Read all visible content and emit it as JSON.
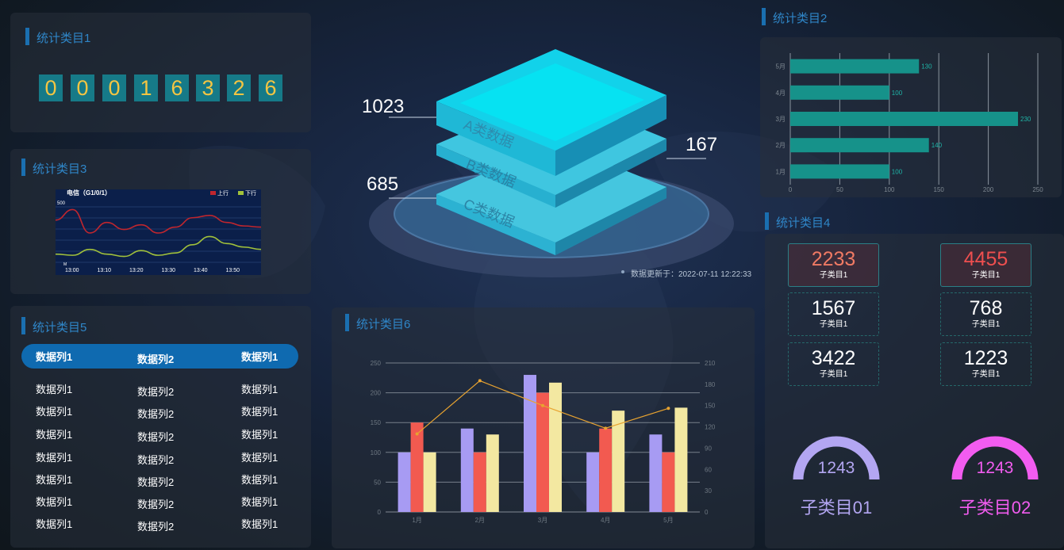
{
  "panels": {
    "p1": {
      "title": "统计类目1",
      "digits": [
        "0",
        "0",
        "0",
        "1",
        "6",
        "3",
        "2",
        "6"
      ]
    },
    "p2": {
      "title": "统计类目2"
    },
    "p3": {
      "title": "统计类目3",
      "chart_title": "电信（G1/0/1）",
      "legend_up": "上行",
      "legend_down": "下行",
      "y_label": "500",
      "y_label2": "M"
    },
    "p4": {
      "title": "统计类目4"
    },
    "p5": {
      "title": "统计类目5",
      "header": [
        "数据列1",
        "数据列2",
        "数据列1"
      ],
      "rows": [
        [
          "数据列1",
          "数据列2",
          "数据列1"
        ],
        [
          "数据列1",
          "数据列2",
          "数据列1"
        ],
        [
          "数据列1",
          "数据列2",
          "数据列1"
        ],
        [
          "数据列1",
          "数据列2",
          "数据列1"
        ],
        [
          "数据列1",
          "数据列2",
          "数据列1"
        ],
        [
          "数据列1",
          "数据列2",
          "数据列1"
        ],
        [
          "数据列1",
          "数据列2",
          "数据列1"
        ]
      ]
    },
    "p6": {
      "title": "统计类目6"
    }
  },
  "center": {
    "layers": [
      "A类数据",
      "B类数据",
      "C类数据"
    ],
    "values": {
      "a": "1023",
      "b": "685",
      "c": "167"
    },
    "update_label": "数据更新于：2022-07-11 12:22:33"
  },
  "stats": [
    {
      "value": "2233",
      "label": "子类目1",
      "color": "#f07a64"
    },
    {
      "value": "4455",
      "label": "子类目1",
      "color": "#ef4f4f"
    },
    {
      "value": "1567",
      "label": "子类目1",
      "color": "#ffffff"
    },
    {
      "value": "768",
      "label": "子类目1",
      "color": "#ffffff"
    },
    {
      "value": "3422",
      "label": "子类目1",
      "color": "#ffffff"
    },
    {
      "value": "1223",
      "label": "子类目1",
      "color": "#ffffff"
    }
  ],
  "gauges": [
    {
      "value": "1243",
      "label": "子类目01",
      "color": "#b3a6f2"
    },
    {
      "value": "1243",
      "label": "子类目02",
      "color": "#f25cf0"
    }
  ],
  "chart_data": [
    {
      "type": "bar",
      "orientation": "horizontal",
      "categories": [
        "1月",
        "2月",
        "3月",
        "4月",
        "5月"
      ],
      "values": [
        100,
        140,
        230,
        100,
        130
      ],
      "xlim": [
        0,
        250
      ],
      "xticks": [
        0,
        50,
        100,
        150,
        200,
        250
      ],
      "grid": true,
      "bar_color": "#16928a"
    },
    {
      "type": "line",
      "x": [
        "13:00",
        "13:10",
        "13:20",
        "13:30",
        "13:40",
        "13:50"
      ],
      "series": [
        {
          "name": "上行",
          "color": "#c0262e",
          "values": [
            360,
            450,
            250,
            340,
            280,
            320,
            250,
            300,
            380,
            400,
            340,
            310,
            300
          ]
        },
        {
          "name": "下行",
          "color": "#a1c13b",
          "values": [
            70,
            60,
            110,
            70,
            50,
            100,
            60,
            80,
            150,
            220,
            160,
            130,
            110
          ]
        }
      ],
      "ylim": [
        0,
        500
      ]
    },
    {
      "type": "bar",
      "categories": [
        "1月",
        "2月",
        "3月",
        "4月",
        "5月"
      ],
      "series": [
        {
          "color": "#a79bf3",
          "values": [
            100,
            140,
            230,
            100,
            130
          ]
        },
        {
          "color": "#f25a50",
          "values": [
            150,
            100,
            200,
            140,
            100
          ]
        },
        {
          "color": "#f3e8a1",
          "values": [
            100,
            130,
            217,
            170,
            175
          ]
        },
        {
          "type": "line",
          "axis": "right",
          "color": "#e8a330",
          "values": [
            110,
            185,
            150,
            118,
            146
          ]
        }
      ],
      "ylim": [
        0,
        250
      ],
      "yticks": [
        0,
        50,
        100,
        150,
        200,
        250
      ],
      "y2lim": [
        0,
        210
      ],
      "y2ticks": [
        0,
        30,
        60,
        90,
        120,
        150,
        180,
        210
      ],
      "grid": true
    }
  ]
}
